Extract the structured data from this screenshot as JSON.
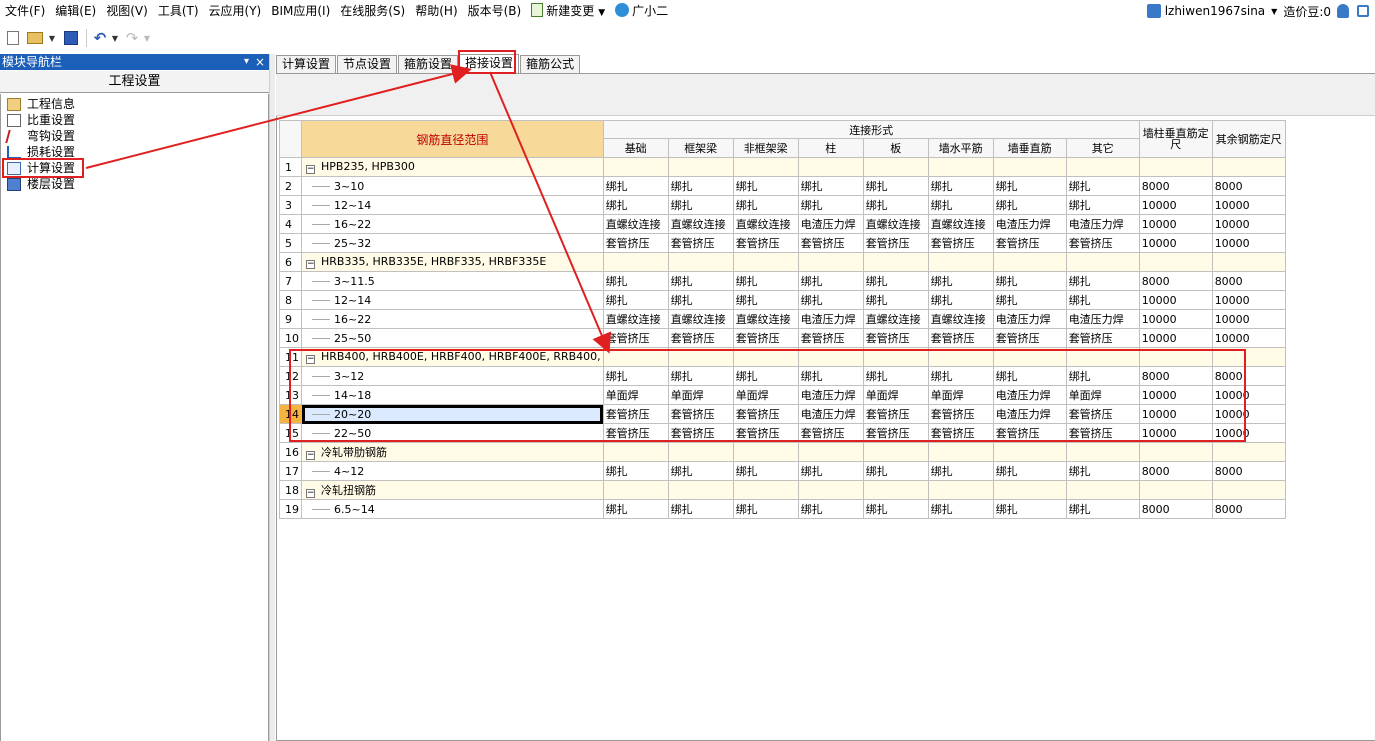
{
  "menu": {
    "items": [
      "文件(F)",
      "编辑(E)",
      "视图(V)",
      "工具(T)",
      "云应用(Y)",
      "BIM应用(I)",
      "在线服务(S)",
      "帮助(H)",
      "版本号(B)"
    ],
    "new_change": "新建变更",
    "assistant": "广小二",
    "user": "lzhiwen1967sina",
    "cost_beans": "造价豆:0"
  },
  "nav": {
    "title": "模块导航栏",
    "pin": "▾",
    "close": "×",
    "header": "工程设置",
    "items": [
      {
        "label": "工程信息",
        "icon": "info-icon"
      },
      {
        "label": "比重设置",
        "icon": "weight-icon"
      },
      {
        "label": "弯钩设置",
        "icon": "hook-icon"
      },
      {
        "label": "损耗设置",
        "icon": "loss-icon"
      },
      {
        "label": "计算设置",
        "icon": "calc-icon"
      },
      {
        "label": "楼层设置",
        "icon": "floor-icon"
      }
    ]
  },
  "tabs": [
    "计算设置",
    "节点设置",
    "箍筋设置",
    "搭接设置",
    "箍筋公式"
  ],
  "active_tab": 3,
  "grid": {
    "range_header": "钢筋直径范围",
    "group_header": "连接形式",
    "columns": [
      "基础",
      "框架梁",
      "非框架梁",
      "柱",
      "板",
      "墙水平筋",
      "墙垂直筋",
      "其它"
    ],
    "col_wall_fixed": "墙柱垂直筋定尺",
    "col_other_fixed": "其余钢筋定尺",
    "rows": [
      {
        "n": "1",
        "group": true,
        "label": "HPB235, HPB300"
      },
      {
        "n": "2",
        "label": "3~10",
        "vals": [
          "绑扎",
          "绑扎",
          "绑扎",
          "绑扎",
          "绑扎",
          "绑扎",
          "绑扎",
          "绑扎"
        ],
        "a": "8000",
        "b": "8000"
      },
      {
        "n": "3",
        "label": "12~14",
        "vals": [
          "绑扎",
          "绑扎",
          "绑扎",
          "绑扎",
          "绑扎",
          "绑扎",
          "绑扎",
          "绑扎"
        ],
        "a": "10000",
        "b": "10000"
      },
      {
        "n": "4",
        "label": "16~22",
        "vals": [
          "直螺纹连接",
          "直螺纹连接",
          "直螺纹连接",
          "电渣压力焊",
          "直螺纹连接",
          "直螺纹连接",
          "电渣压力焊",
          "电渣压力焊"
        ],
        "a": "10000",
        "b": "10000"
      },
      {
        "n": "5",
        "label": "25~32",
        "vals": [
          "套管挤压",
          "套管挤压",
          "套管挤压",
          "套管挤压",
          "套管挤压",
          "套管挤压",
          "套管挤压",
          "套管挤压"
        ],
        "a": "10000",
        "b": "10000"
      },
      {
        "n": "6",
        "group": true,
        "label": "HRB335, HRB335E, HRBF335, HRBF335E"
      },
      {
        "n": "7",
        "label": "3~11.5",
        "vals": [
          "绑扎",
          "绑扎",
          "绑扎",
          "绑扎",
          "绑扎",
          "绑扎",
          "绑扎",
          "绑扎"
        ],
        "a": "8000",
        "b": "8000"
      },
      {
        "n": "8",
        "label": "12~14",
        "vals": [
          "绑扎",
          "绑扎",
          "绑扎",
          "绑扎",
          "绑扎",
          "绑扎",
          "绑扎",
          "绑扎"
        ],
        "a": "10000",
        "b": "10000"
      },
      {
        "n": "9",
        "label": "16~22",
        "vals": [
          "直螺纹连接",
          "直螺纹连接",
          "直螺纹连接",
          "电渣压力焊",
          "直螺纹连接",
          "直螺纹连接",
          "电渣压力焊",
          "电渣压力焊"
        ],
        "a": "10000",
        "b": "10000"
      },
      {
        "n": "10",
        "label": "25~50",
        "vals": [
          "套管挤压",
          "套管挤压",
          "套管挤压",
          "套管挤压",
          "套管挤压",
          "套管挤压",
          "套管挤压",
          "套管挤压"
        ],
        "a": "10000",
        "b": "10000"
      },
      {
        "n": "11",
        "group": true,
        "label": "HRB400, HRB400E, HRBF400, HRBF400E, RRB400,"
      },
      {
        "n": "12",
        "label": "3~12",
        "vals": [
          "绑扎",
          "绑扎",
          "绑扎",
          "绑扎",
          "绑扎",
          "绑扎",
          "绑扎",
          "绑扎"
        ],
        "a": "8000",
        "b": "8000"
      },
      {
        "n": "13",
        "label": "14~18",
        "vals": [
          "单面焊",
          "单面焊",
          "单面焊",
          "电渣压力焊",
          "单面焊",
          "单面焊",
          "电渣压力焊",
          "单面焊"
        ],
        "a": "10000",
        "b": "10000"
      },
      {
        "n": "14",
        "label": "20~20",
        "vals": [
          "套管挤压",
          "套管挤压",
          "套管挤压",
          "电渣压力焊",
          "套管挤压",
          "套管挤压",
          "电渣压力焊",
          "套管挤压"
        ],
        "a": "10000",
        "b": "10000",
        "selected": true
      },
      {
        "n": "15",
        "label": "22~50",
        "vals": [
          "套管挤压",
          "套管挤压",
          "套管挤压",
          "套管挤压",
          "套管挤压",
          "套管挤压",
          "套管挤压",
          "套管挤压"
        ],
        "a": "10000",
        "b": "10000"
      },
      {
        "n": "16",
        "group": true,
        "label": "冷轧带肋钢筋"
      },
      {
        "n": "17",
        "label": "4~12",
        "vals": [
          "绑扎",
          "绑扎",
          "绑扎",
          "绑扎",
          "绑扎",
          "绑扎",
          "绑扎",
          "绑扎"
        ],
        "a": "8000",
        "b": "8000"
      },
      {
        "n": "18",
        "group": true,
        "label": "冷轧扭钢筋"
      },
      {
        "n": "19",
        "label": "6.5~14",
        "vals": [
          "绑扎",
          "绑扎",
          "绑扎",
          "绑扎",
          "绑扎",
          "绑扎",
          "绑扎",
          "绑扎"
        ],
        "a": "8000",
        "b": "8000"
      }
    ]
  },
  "colors": {
    "annotation": "#e02020",
    "nav_title_bg": "#1c5fb8",
    "range_header_bg": "#f7d99a",
    "group_row_bg": "#fffbe6"
  }
}
